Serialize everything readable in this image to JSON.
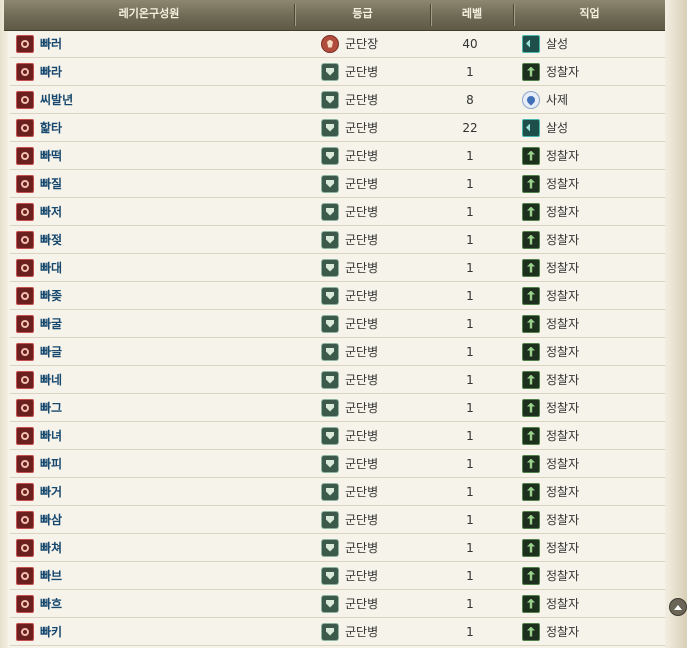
{
  "header": {
    "col_name": "레기온구성원",
    "col_rank": "등급",
    "col_level": "레벨",
    "col_job": "직업"
  },
  "rows": [
    {
      "name": "빠러",
      "rank": "군단장",
      "rank_icon": "legion-leader-icon",
      "level": "40",
      "job": "살성",
      "job_icon": "assassin-class-icon"
    },
    {
      "name": "빠라",
      "rank": "군단병",
      "rank_icon": "legionary-icon",
      "level": "1",
      "job": "정찰자",
      "job_icon": "ranger-class-icon"
    },
    {
      "name": "씨발년",
      "rank": "군단병",
      "rank_icon": "legionary-icon",
      "level": "8",
      "job": "사제",
      "job_icon": "cleric-class-icon"
    },
    {
      "name": "핥타",
      "rank": "군단병",
      "rank_icon": "legionary-icon",
      "level": "22",
      "job": "살성",
      "job_icon": "assassin-class-icon"
    },
    {
      "name": "빠떡",
      "rank": "군단병",
      "rank_icon": "legionary-icon",
      "level": "1",
      "job": "정찰자",
      "job_icon": "ranger-class-icon"
    },
    {
      "name": "빠질",
      "rank": "군단병",
      "rank_icon": "legionary-icon",
      "level": "1",
      "job": "정찰자",
      "job_icon": "ranger-class-icon"
    },
    {
      "name": "빠저",
      "rank": "군단병",
      "rank_icon": "legionary-icon",
      "level": "1",
      "job": "정찰자",
      "job_icon": "ranger-class-icon"
    },
    {
      "name": "빠젖",
      "rank": "군단병",
      "rank_icon": "legionary-icon",
      "level": "1",
      "job": "정찰자",
      "job_icon": "ranger-class-icon"
    },
    {
      "name": "빠대",
      "rank": "군단병",
      "rank_icon": "legionary-icon",
      "level": "1",
      "job": "정찰자",
      "job_icon": "ranger-class-icon"
    },
    {
      "name": "빠좆",
      "rank": "군단병",
      "rank_icon": "legionary-icon",
      "level": "1",
      "job": "정찰자",
      "job_icon": "ranger-class-icon"
    },
    {
      "name": "빠굴",
      "rank": "군단병",
      "rank_icon": "legionary-icon",
      "level": "1",
      "job": "정찰자",
      "job_icon": "ranger-class-icon"
    },
    {
      "name": "빠글",
      "rank": "군단병",
      "rank_icon": "legionary-icon",
      "level": "1",
      "job": "정찰자",
      "job_icon": "ranger-class-icon"
    },
    {
      "name": "빠네",
      "rank": "군단병",
      "rank_icon": "legionary-icon",
      "level": "1",
      "job": "정찰자",
      "job_icon": "ranger-class-icon"
    },
    {
      "name": "빠그",
      "rank": "군단병",
      "rank_icon": "legionary-icon",
      "level": "1",
      "job": "정찰자",
      "job_icon": "ranger-class-icon"
    },
    {
      "name": "빠녀",
      "rank": "군단병",
      "rank_icon": "legionary-icon",
      "level": "1",
      "job": "정찰자",
      "job_icon": "ranger-class-icon"
    },
    {
      "name": "빠피",
      "rank": "군단병",
      "rank_icon": "legionary-icon",
      "level": "1",
      "job": "정찰자",
      "job_icon": "ranger-class-icon"
    },
    {
      "name": "빠거",
      "rank": "군단병",
      "rank_icon": "legionary-icon",
      "level": "1",
      "job": "정찰자",
      "job_icon": "ranger-class-icon"
    },
    {
      "name": "빠삼",
      "rank": "군단병",
      "rank_icon": "legionary-icon",
      "level": "1",
      "job": "정찰자",
      "job_icon": "ranger-class-icon"
    },
    {
      "name": "빠쳐",
      "rank": "군단병",
      "rank_icon": "legionary-icon",
      "level": "1",
      "job": "정찰자",
      "job_icon": "ranger-class-icon"
    },
    {
      "name": "빠브",
      "rank": "군단병",
      "rank_icon": "legionary-icon",
      "level": "1",
      "job": "정찰자",
      "job_icon": "ranger-class-icon"
    },
    {
      "name": "빠흐",
      "rank": "군단병",
      "rank_icon": "legionary-icon",
      "level": "1",
      "job": "정찰자",
      "job_icon": "ranger-class-icon"
    },
    {
      "name": "빠키",
      "rank": "군단병",
      "rank_icon": "legionary-icon",
      "level": "1",
      "job": "정찰자",
      "job_icon": "ranger-class-icon"
    }
  ],
  "member_icon": "legion-member-icon",
  "scroll_top_icon": "scroll-to-top-icon",
  "colors": {
    "header_bg": "#6f6a55",
    "name_text": "#16476e",
    "page_bg": "#f6f3ea"
  }
}
